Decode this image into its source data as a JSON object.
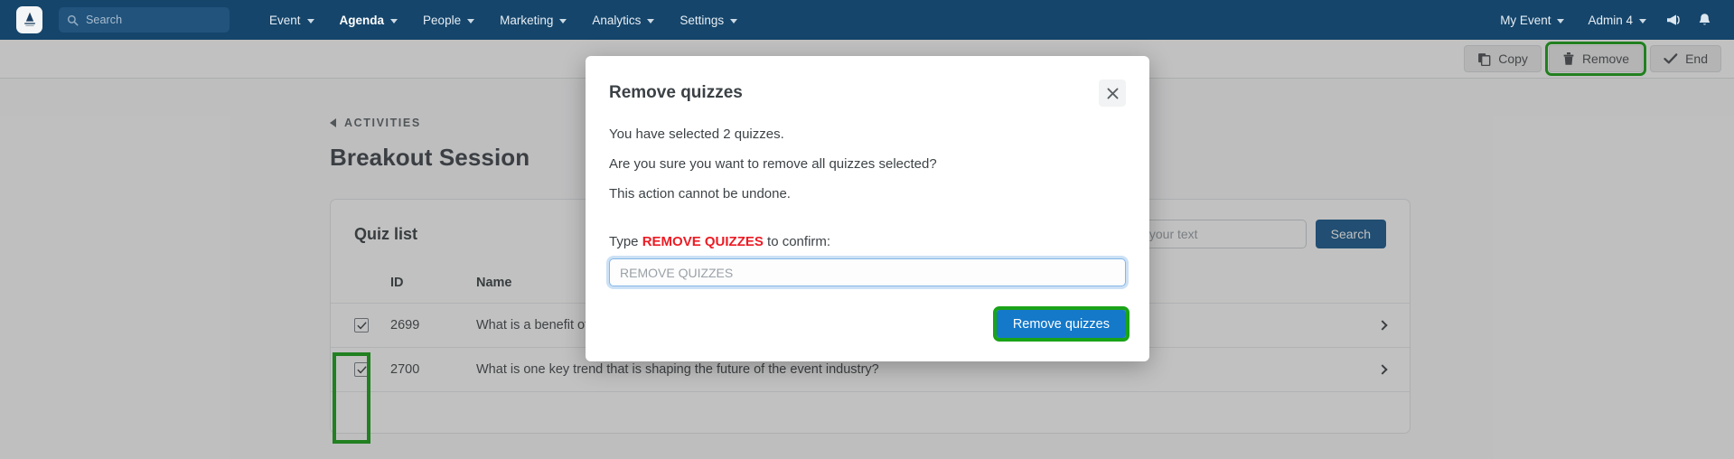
{
  "navbar": {
    "logo_icon": "brand-logo-icon",
    "search": {
      "icon": "search-icon",
      "placeholder": "Search",
      "value": ""
    },
    "items": [
      {
        "label": "Event",
        "icon": "chevron-down-icon",
        "active": false
      },
      {
        "label": "Agenda",
        "icon": "chevron-down-icon",
        "active": true
      },
      {
        "label": "People",
        "icon": "chevron-down-icon",
        "active": false
      },
      {
        "label": "Marketing",
        "icon": "chevron-down-icon",
        "active": false
      },
      {
        "label": "Analytics",
        "icon": "chevron-down-icon",
        "active": false
      },
      {
        "label": "Settings",
        "icon": "chevron-down-icon",
        "active": false
      }
    ],
    "right": {
      "event_label": "My Event",
      "admin_label": "Admin 4",
      "announcement_icon": "megaphone-icon",
      "notification_icon": "bell-icon"
    },
    "bg_color": "#15456b"
  },
  "toolbar": {
    "copy_label": "Copy",
    "copy_icon": "copy-icon",
    "remove_label": "Remove",
    "remove_icon": "trash-icon",
    "remove_highlighted": true,
    "end_label": "End",
    "end_icon": "check-icon",
    "highlight_color": "#1aa319"
  },
  "page": {
    "breadcrumb": "ACTIVITIES",
    "breadcrumb_icon": "back-arrow-icon",
    "title": "Breakout Session"
  },
  "card": {
    "title": "Quiz list",
    "search_placeholder": "Type your text",
    "search_value": "",
    "search_button": "Search",
    "columns": [
      "",
      "ID",
      "Name",
      ""
    ],
    "rows": [
      {
        "checked": true,
        "id": "2699",
        "name": "What is a benefit of attending an event?",
        "arrow_icon": "chevron-right-icon"
      },
      {
        "checked": true,
        "id": "2700",
        "name": "What is one key trend that is shaping the future of the event industry?",
        "arrow_icon": "chevron-right-icon"
      }
    ],
    "checkbox_highlighted": true
  },
  "modal": {
    "title": "Remove quizzes",
    "close_icon": "close-icon",
    "lines": [
      "You have selected 2 quizzes.",
      "Are you sure you want to remove all quizzes selected?",
      "This action cannot be undone."
    ],
    "confirm_prefix": "Type ",
    "confirm_keyword": "REMOVE QUIZZES",
    "confirm_suffix": " to confirm:",
    "confirm_placeholder": "REMOVE QUIZZES",
    "confirm_value": "",
    "submit_label": "Remove quizzes",
    "submit_highlighted": true,
    "keyword_color": "#ec1c24",
    "submit_color": "#1479c9"
  }
}
